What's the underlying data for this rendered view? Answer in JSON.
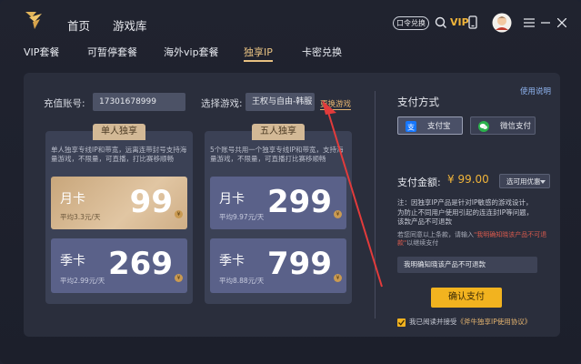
{
  "colors": {
    "accent_gold": "#e7c182",
    "confirm_yellow": "#f2b31f",
    "alipay_blue": "#1677ff",
    "wechat_green": "#2bb24c",
    "arrow_red": "#e23b3b"
  },
  "topbar": {
    "nav": [
      "首页",
      "游戏库"
    ],
    "code_button": "口令兑换",
    "vip_label": "VIP",
    "icons": [
      "search-icon",
      "phone-icon",
      "avatar",
      "menu-icon",
      "minimize-icon",
      "close-icon"
    ]
  },
  "subnav": {
    "tabs": [
      "VIP套餐",
      "可暂停套餐",
      "海外vip套餐",
      "独享IP",
      "卡密兑换"
    ],
    "active": "独享IP"
  },
  "form": {
    "account_label": "充值账号:",
    "account_value": "17301678999",
    "game_label": "选择游戏:",
    "game_value": "王权与自由-韩服",
    "change_game": "更换游戏",
    "help_link": "使用说明"
  },
  "plans": [
    {
      "tab": "单人独享",
      "desc": "单人独享专线IP和带宽，远离连带封号支持海量游戏，不限量，可直播，打比赛移顺畅",
      "options": [
        {
          "name": "月卡",
          "unit": "平均3.3元/天",
          "price": "99",
          "style": "gold"
        },
        {
          "name": "季卡",
          "unit": "平均2.99元/天",
          "price": "269",
          "style": "blue"
        }
      ]
    },
    {
      "tab": "五人独享",
      "desc": "5个账号共用一个独享专线IP和带宽，支持海量游戏，不限量，可直播打比赛移顺畅",
      "options": [
        {
          "name": "月卡",
          "unit": "平均9.97元/天",
          "price": "299",
          "style": "blue"
        },
        {
          "name": "季卡",
          "unit": "平均8.88元/天",
          "price": "799",
          "style": "blue"
        }
      ]
    }
  ],
  "payment": {
    "title": "支付方式",
    "alipay": "支付宝",
    "wechat": "微信支付",
    "amount_label": "支付金额:",
    "amount": "¥ 99.00",
    "coupon": "选可用优惠",
    "note_lines": [
      "注：因独享IP产品是针对IP敏感的游戏设计，",
      "为防止不同用户使用引起的连连封IP等问题，",
      "该款产品不可退款"
    ],
    "confirm_lines_1": "若您同意以上条款，请输入",
    "confirm_highlight": "\"我明确知晓该产品不可退款\"",
    "confirm_tail": "以继续支付",
    "confirm_input": "我明确知晓该产品不可退款",
    "confirm_button": "确认支付",
    "agree_prefix": "我已阅读并接受",
    "agree_link": "《斧牛独享IP使用协议》"
  }
}
